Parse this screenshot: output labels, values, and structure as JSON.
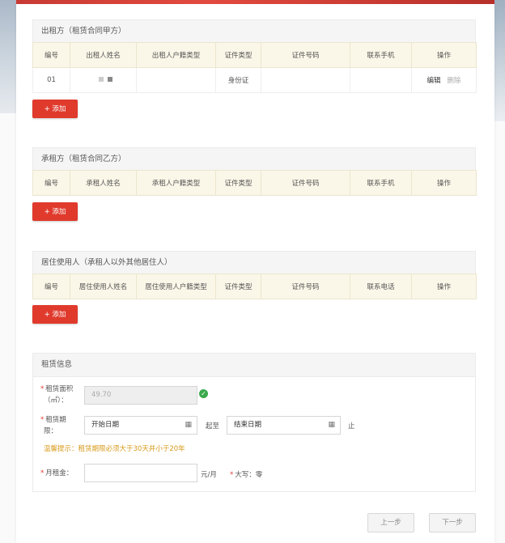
{
  "lessor": {
    "title": "出租方（租赁合同甲方）",
    "columns": [
      "编号",
      "出租人姓名",
      "出租人户籍类型",
      "证件类型",
      "证件号码",
      "联系手机",
      "操作"
    ],
    "rows": [
      {
        "no": "01",
        "id_type": "身份证",
        "edit": "编辑",
        "delete": "删除"
      }
    ],
    "add_label": "+ 添加"
  },
  "lessee": {
    "title": "承租方（租赁合同乙方）",
    "columns": [
      "编号",
      "承租人姓名",
      "承租人户籍类型",
      "证件类型",
      "证件号码",
      "联系手机",
      "操作"
    ],
    "add_label": "+ 添加"
  },
  "resident": {
    "title": "居住使用人（承租人以外其他居住人）",
    "columns": [
      "编号",
      "居住使用人姓名",
      "居住使用人户籍类型",
      "证件类型",
      "证件号码",
      "联系电话",
      "操作"
    ],
    "add_label": "+ 添加"
  },
  "lease": {
    "title": "租赁信息",
    "area_label_1": "租赁面积",
    "area_label_2": "（㎡）：",
    "area_value": "49.70",
    "term_label_1": "租赁期",
    "term_label_2": "限：",
    "start_placeholder": "开始日期",
    "from_text": "起至",
    "end_placeholder": "结束日期",
    "until_text": "止",
    "hint": "温馨提示：租赁期限必须大于30天并小于20年",
    "rent_label": "月租金：",
    "rent_unit": "元/月",
    "capital_label": "大写：",
    "capital_value": "零"
  },
  "nav": {
    "prev": "上一步",
    "next": "下一步"
  },
  "colors": {
    "accent": "#e03a2d",
    "header_bg": "#fbf7e8",
    "hint": "#d89a1a",
    "success": "#3aa84b"
  }
}
